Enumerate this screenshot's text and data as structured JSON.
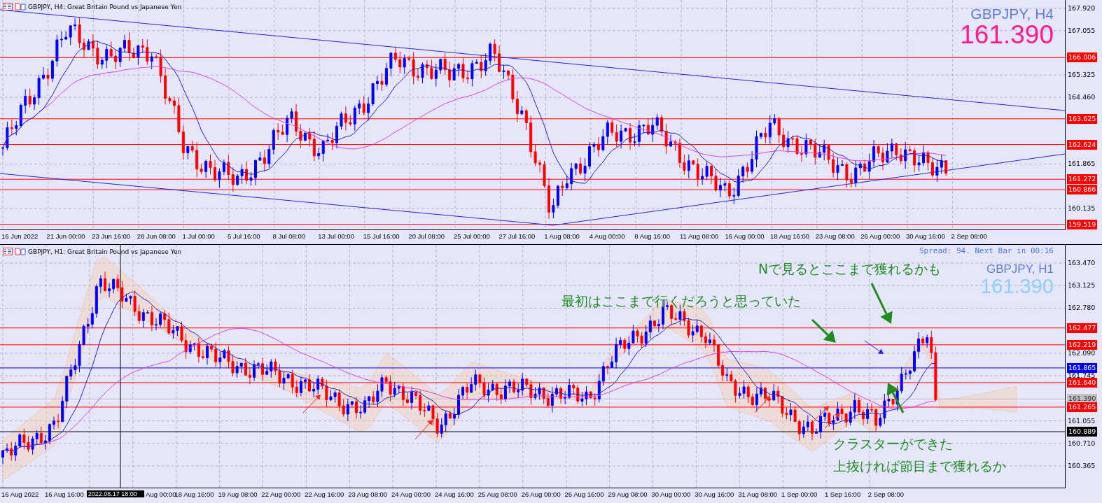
{
  "panels": [
    {
      "header": "GBPJPY, H4:  Great Britain Pound vs Japanese Yen",
      "symbol_label": "GBPJPY, H4",
      "price": "161.390",
      "price_ticks": [
        "167.920",
        "167.055",
        "165.325",
        "164.460",
        "161.865",
        "160.135"
      ],
      "level_tags": [
        {
          "text": "166.006",
          "color": "#ff0000"
        },
        {
          "text": "163.625",
          "color": "#ff0000"
        },
        {
          "text": "162.624",
          "color": "#ff0000"
        },
        {
          "text": "161.272",
          "color": "#ff0000"
        },
        {
          "text": "160.866",
          "color": "#ff0000"
        },
        {
          "text": "159.519",
          "color": "#ff0000"
        }
      ],
      "time_labels": [
        {
          "text": "16 Jun 2022",
          "kind": "tick"
        },
        {
          "text": "21 Jun 00:00",
          "kind": "tick"
        },
        {
          "text": "23 Jun 16:00",
          "kind": "tick"
        },
        {
          "text": "28 Jun 08:00",
          "kind": "tick"
        },
        {
          "text": "1 Jul 00:00",
          "kind": "tick"
        },
        {
          "text": "5 Jul 16:00",
          "kind": "tick"
        },
        {
          "text": "8 Jul 08:00",
          "kind": "tick"
        },
        {
          "text": "13 Jul 00:00",
          "kind": "tick"
        },
        {
          "text": "15 Jul 16:00",
          "kind": "tick"
        },
        {
          "text": "20 Jul 08:00",
          "kind": "tick"
        },
        {
          "text": "25 Jul 00:00",
          "kind": "tick"
        },
        {
          "text": "27 Jul 16:00",
          "kind": "tick"
        },
        {
          "text": "1 Aug 08:00",
          "kind": "tick"
        },
        {
          "text": "4 Aug 00:00",
          "kind": "tick"
        },
        {
          "text": "8 Aug 16:00",
          "kind": "tick"
        },
        {
          "text": "11 Aug 08:00",
          "kind": "tick"
        },
        {
          "text": "16 Aug 00:00",
          "kind": "tick"
        },
        {
          "text": "18 Aug 16:00",
          "kind": "tick"
        },
        {
          "text": "23 Aug 08:00",
          "kind": "tick"
        },
        {
          "text": "26 Aug 00:00",
          "kind": "tick"
        },
        {
          "text": "30 Aug 16:00",
          "kind": "tick"
        },
        {
          "text": "2 Sep 08:00",
          "kind": "tick"
        }
      ]
    },
    {
      "header": "GBPJPY, H1:  Great Britain Pound vs Japanese Yen",
      "symbol_label": "GBPJPY, H1",
      "price": "161.390",
      "spread_info": "Spread: 94. Next Bar in 00:16",
      "price_ticks": [
        "163.470",
        "163.125",
        "162.780",
        "162.090",
        "161.745",
        "161.055",
        "160.710",
        "160.365"
      ],
      "level_tags": [
        {
          "text": "162.477",
          "color": "#ff0000"
        },
        {
          "text": "162.219",
          "color": "#ff0000"
        },
        {
          "text": "161.865",
          "color": "#0000ff"
        },
        {
          "text": "161.640",
          "color": "#ff0000"
        },
        {
          "text": "161.390",
          "color": "#c0c0c0"
        },
        {
          "text": "161.265",
          "color": "#ff0000"
        },
        {
          "text": "160.889",
          "color": "#000000"
        }
      ],
      "time_labels": [
        {
          "text": "16 Aug 2022",
          "kind": "tick"
        },
        {
          "text": "16 Aug 16:00",
          "kind": "tick"
        },
        {
          "text": "2022.08.17 18:00",
          "kind": "cursor"
        },
        {
          "text": "Aug 00:00",
          "kind": "partial"
        },
        {
          "text": "18 Aug 16:00",
          "kind": "tick"
        },
        {
          "text": "19 Aug 08:00",
          "kind": "tick"
        },
        {
          "text": "22 Aug 00:00",
          "kind": "tick"
        },
        {
          "text": "22 Aug 16:00",
          "kind": "tick"
        },
        {
          "text": "23 Aug 08:00",
          "kind": "tick"
        },
        {
          "text": "24 Aug 00:00",
          "kind": "tick"
        },
        {
          "text": "24 Aug 16:00",
          "kind": "tick"
        },
        {
          "text": "25 Aug 08:00",
          "kind": "tick"
        },
        {
          "text": "26 Aug 00:00",
          "kind": "tick"
        },
        {
          "text": "26 Aug 16:00",
          "kind": "tick"
        },
        {
          "text": "29 Aug 08:00",
          "kind": "tick"
        },
        {
          "text": "30 Aug 00:00",
          "kind": "tick"
        },
        {
          "text": "30 Aug 16:00",
          "kind": "tick"
        },
        {
          "text": "31 Aug 08:00",
          "kind": "tick"
        },
        {
          "text": "1 Sep 00:00",
          "kind": "tick"
        },
        {
          "text": "1 Sep 16:00",
          "kind": "tick"
        },
        {
          "text": "2 Sep 08:00",
          "kind": "tick"
        }
      ],
      "notes": [
        "Nで見るとここまで獲れるかも",
        "最初はここまで行くだろうと思っていた",
        "クラスターができた",
        "上抜ければ節目まで獲れるか"
      ]
    }
  ]
}
